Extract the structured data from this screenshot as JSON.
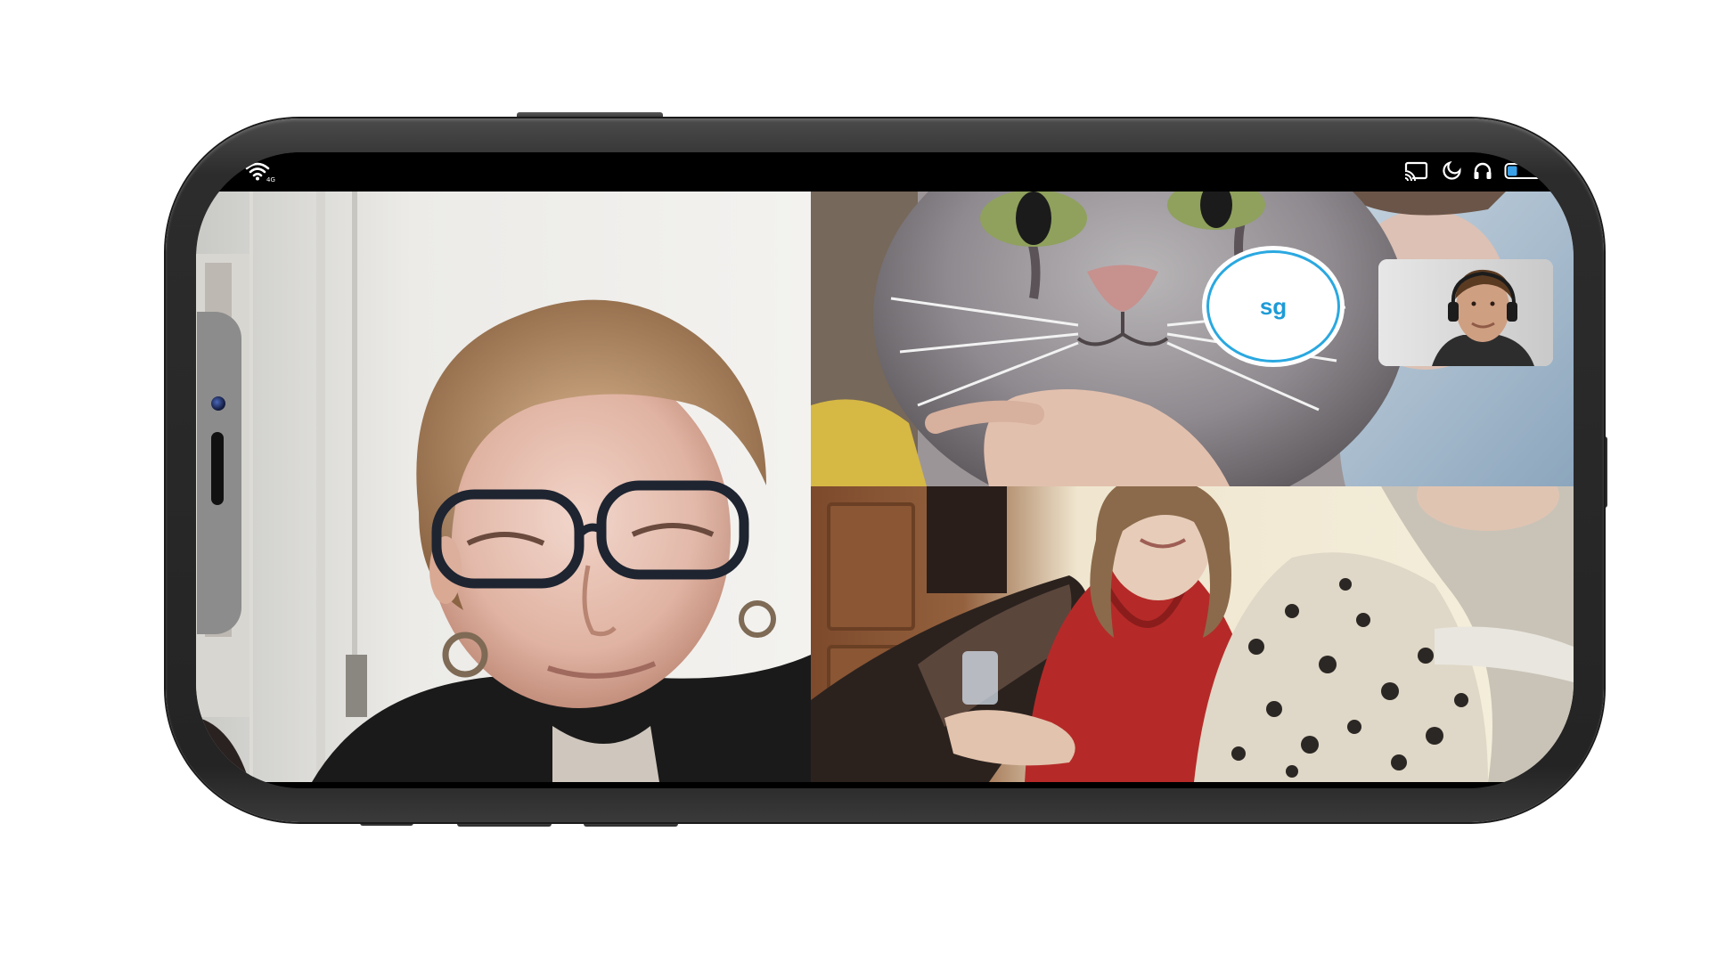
{
  "app": "Video call",
  "status_bar": {
    "wifi_network_label": "4G",
    "icons": [
      "wifi-icon",
      "cast-icon",
      "moon-icon",
      "headphones-icon",
      "battery-icon"
    ],
    "battery_level": 0.3
  },
  "call": {
    "participants": [
      {
        "tile": "main-left",
        "description_icon": "participant-video"
      },
      {
        "tile": "top-right",
        "description_icon": "participant-video"
      },
      {
        "tile": "bottom-right",
        "description_icon": "participant-video"
      }
    ],
    "avatar_badge": {
      "initials": "sg"
    },
    "self_view": {
      "icon": "self-camera-preview"
    }
  },
  "colors": {
    "accent": "#2aa8e0",
    "initials": "#1e9bd7",
    "battery_fill": "#3aa0e8",
    "phone_frame": "#2c2c2c"
  }
}
